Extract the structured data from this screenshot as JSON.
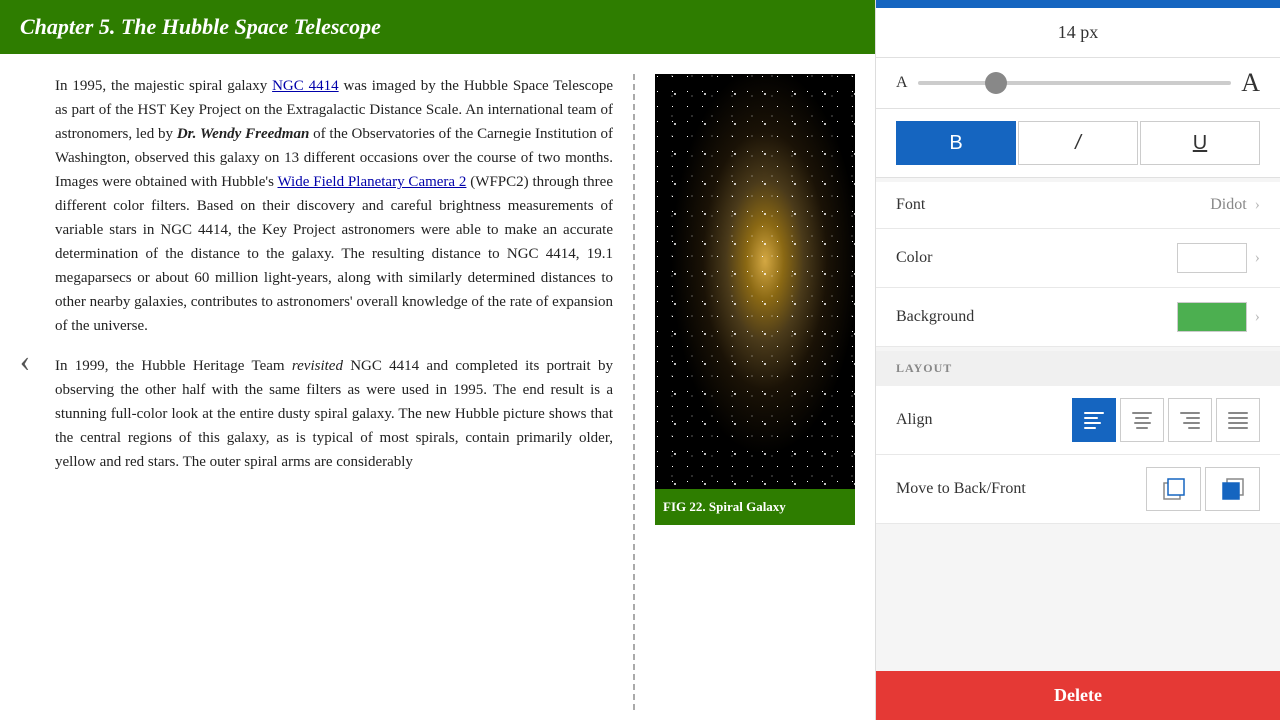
{
  "chapter": {
    "title": "Chapter 5. The Hubble Space Telescope"
  },
  "content": {
    "paragraph1": "In 1995, the majestic spiral galaxy NGC 4414 was imaged by the Hubble Space Telescope as part of the HST Key Project on the Extragalactic Distance Scale. An international team of astronomers, led by Dr. Wendy Freedman of the Observatories of the Carnegie Institution of Washington, observed this galaxy on 13 different occasions over the course of two months. Images were obtained with Hubble's Wide Field Planetary Camera 2 (WFPC2) through three different color filters. Based on their discovery and careful brightness measurements of variable stars in NGC 4414, the Key Project astronomers were able to make an accurate determination of the distance to the galaxy. The resulting distance to NGC 4414, 19.1 megaparsecs or about 60 million light-years, along with similarly determined distances to other nearby galaxies, contributes to astronomers' overall knowledge of the rate of expansion of the universe.",
    "paragraph2": "In 1999, the Hubble Heritage Team revisited NGC 4414 and completed its portrait by observing the other half with the same filters as were used in 1995. The end result is a stunning full-color look at the entire dusty spiral galaxy. The new Hubble picture shows that the central regions of this galaxy, as is typical of most spirals, contain primarily older, yellow and red stars. The outer spiral arms are considerably",
    "ngc_link": "NGC 4414",
    "wfpc2_link": "Wide Field Planetary Camera 2",
    "bold_italic_text": "Dr. Wendy Freedman",
    "revisited_italic": "revisited",
    "fig_caption_bold": "FIG 22.",
    "fig_caption_text": " Spiral Galaxy"
  },
  "right_panel": {
    "font_size": "14 px",
    "font_label": "Font",
    "font_value": "Didot",
    "color_label": "Color",
    "background_label": "Background",
    "layout_section": "LAYOUT",
    "align_label": "Align",
    "move_label": "Move to Back/Front",
    "delete_label": "Delete",
    "bold_label": "B",
    "italic_label": "/",
    "underline_label": "U",
    "small_a": "A",
    "large_a": "A"
  }
}
